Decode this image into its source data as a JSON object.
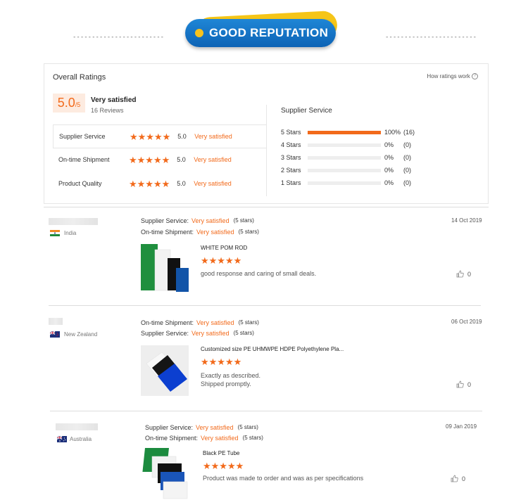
{
  "banner": {
    "title": "GOOD REPUTATION",
    "dashes_left": "------------------------",
    "dashes_right": "------------------------"
  },
  "overall": {
    "heading": "Overall Ratings",
    "how_link": "How ratings work",
    "score": "5.0",
    "score_max": "/5",
    "score_label": "Very satisfied",
    "reviews": "16 Reviews",
    "metrics": [
      {
        "label": "Supplier Service",
        "stars": "★★★★★",
        "value": "5.0",
        "text": "Very satisfied"
      },
      {
        "label": "On-time Shipment",
        "stars": "★★★★★",
        "value": "5.0",
        "text": "Very satisfied"
      },
      {
        "label": "Product Quality",
        "stars": "★★★★★",
        "value": "5.0",
        "text": "Very satisfied"
      }
    ],
    "service_title": "Supplier Service",
    "distribution": [
      {
        "label": "5  Stars",
        "pct": "100%",
        "count": "(16)",
        "fill": 1.0
      },
      {
        "label": "4  Stars",
        "pct": "0%",
        "count": "(0)",
        "fill": 0
      },
      {
        "label": "3  Stars",
        "pct": "0%",
        "count": "(0)",
        "fill": 0
      },
      {
        "label": "2  Stars",
        "pct": "0%",
        "count": "(0)",
        "fill": 0
      },
      {
        "label": "1  Stars",
        "pct": "0%",
        "count": "(0)",
        "fill": 0
      }
    ]
  },
  "reviews": [
    {
      "country": "India",
      "line1": {
        "key": "Supplier Service:",
        "value": "Very satisfied",
        "count": "(5 stars)"
      },
      "line2": {
        "key": "On-time Shipment:",
        "value": "Very satisfied",
        "count": "(5 stars)"
      },
      "date": "14 Oct 2019",
      "product": "WHITE POM ROD",
      "stars": "★★★★★",
      "text1": "good response and caring of small deals.",
      "text2": "",
      "likes": "0"
    },
    {
      "country": "New Zealand",
      "line1": {
        "key": "On-time Shipment:",
        "value": "Very satisfied",
        "count": "(5 stars)"
      },
      "line2": {
        "key": "Supplier Service:",
        "value": "Very satisfied",
        "count": "(5 stars)"
      },
      "date": "06 Oct 2019",
      "product": "Customized size PE UHMWPE HDPE Polyethylene Pla...",
      "stars": "★★★★★",
      "text1": "Exactly as described.",
      "text2": "Shipped promptly.",
      "likes": "0"
    },
    {
      "country": "Australia",
      "line1": {
        "key": "Supplier Service:",
        "value": "Very satisfied",
        "count": "(5 stars)"
      },
      "line2": {
        "key": "On-time Shipment:",
        "value": "Very satisfied",
        "count": "(5 stars)"
      },
      "date": "09 Jan 2019",
      "product": "Black PE Tube",
      "stars": "★★★★★",
      "text1": "Product was made to order and was as per specifications",
      "text2": "",
      "likes": "0"
    }
  ],
  "colors": {
    "accent": "#f26a1b",
    "banner_blue": "#1578c9",
    "banner_yellow": "#f5c518"
  },
  "icons": [
    "info-icon",
    "thumbs-up-icon",
    "india-flag-icon",
    "new-zealand-flag-icon",
    "australia-flag-icon"
  ]
}
